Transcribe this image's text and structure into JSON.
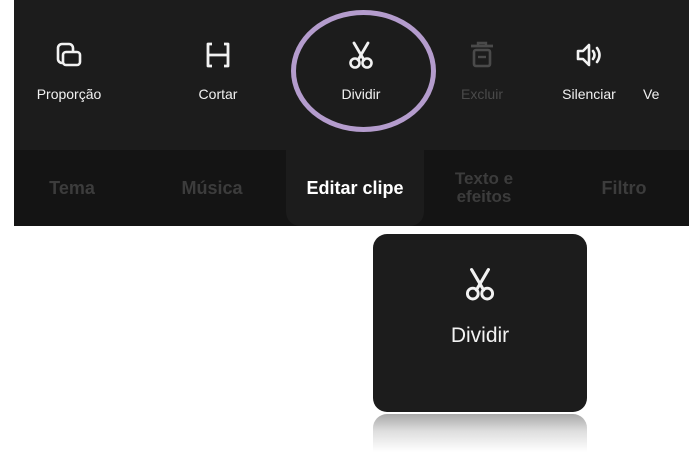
{
  "toolbar": {
    "tools": [
      {
        "label": "Proporção",
        "icon": "aspect-ratio-icon",
        "enabled": true
      },
      {
        "label": "Cortar",
        "icon": "trim-icon",
        "enabled": true
      },
      {
        "label": "Dividir",
        "icon": "scissors-icon",
        "enabled": true,
        "highlighted": true
      },
      {
        "label": "Excluir",
        "icon": "trash-icon",
        "enabled": false
      },
      {
        "label": "Silenciar",
        "icon": "speaker-icon",
        "enabled": true
      },
      {
        "label": "Ve",
        "icon": "",
        "enabled": true
      }
    ],
    "highlight_color": "#b49ccd"
  },
  "tabs": {
    "items": [
      {
        "label": "Tema",
        "active": false
      },
      {
        "label": "Música",
        "active": false
      },
      {
        "label": "Editar clipe",
        "active": true
      },
      {
        "label_line1": "Texto e",
        "label_line2": "efeitos",
        "active": false
      },
      {
        "label": "Filtro",
        "active": false
      }
    ]
  },
  "zoom_callout": {
    "label": "Dividir",
    "icon": "scissors-icon"
  },
  "colors": {
    "panel": "#1c1c1c",
    "tab_bar": "#141414",
    "text": "#f2f2f2",
    "disabled": "#4a4a4a",
    "inactive_tab": "#3c3c3c"
  }
}
